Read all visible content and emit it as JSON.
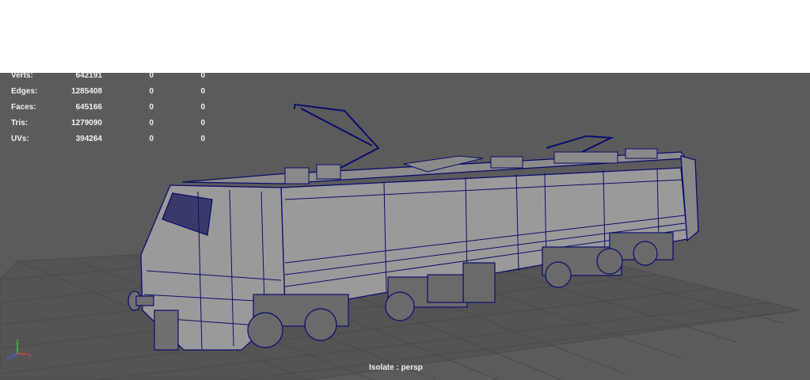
{
  "hud": {
    "rows": [
      {
        "label": "Verts:",
        "total": "642191",
        "selected": "0",
        "visible": "0"
      },
      {
        "label": "Edges:",
        "total": "1285408",
        "selected": "0",
        "visible": "0"
      },
      {
        "label": "Faces:",
        "total": "645166",
        "selected": "0",
        "visible": "0"
      },
      {
        "label": "Tris:",
        "total": "1279090",
        "selected": "0",
        "visible": "0"
      },
      {
        "label": "UVs:",
        "total": "394264",
        "selected": "0",
        "visible": "0"
      }
    ]
  },
  "viewport": {
    "camera_label": "Isolate : persp",
    "background_color": "#5b5b5b",
    "grid_color": "#4a4a4a",
    "wireframe_color": "#0c0c6e",
    "model_fill_color": "#9a9a9a"
  },
  "axis_gizmo": {
    "x_label": "x",
    "y_label": "y",
    "z_label": "z",
    "x_color": "#e04040",
    "y_color": "#40c040",
    "z_color": "#4060ff"
  }
}
